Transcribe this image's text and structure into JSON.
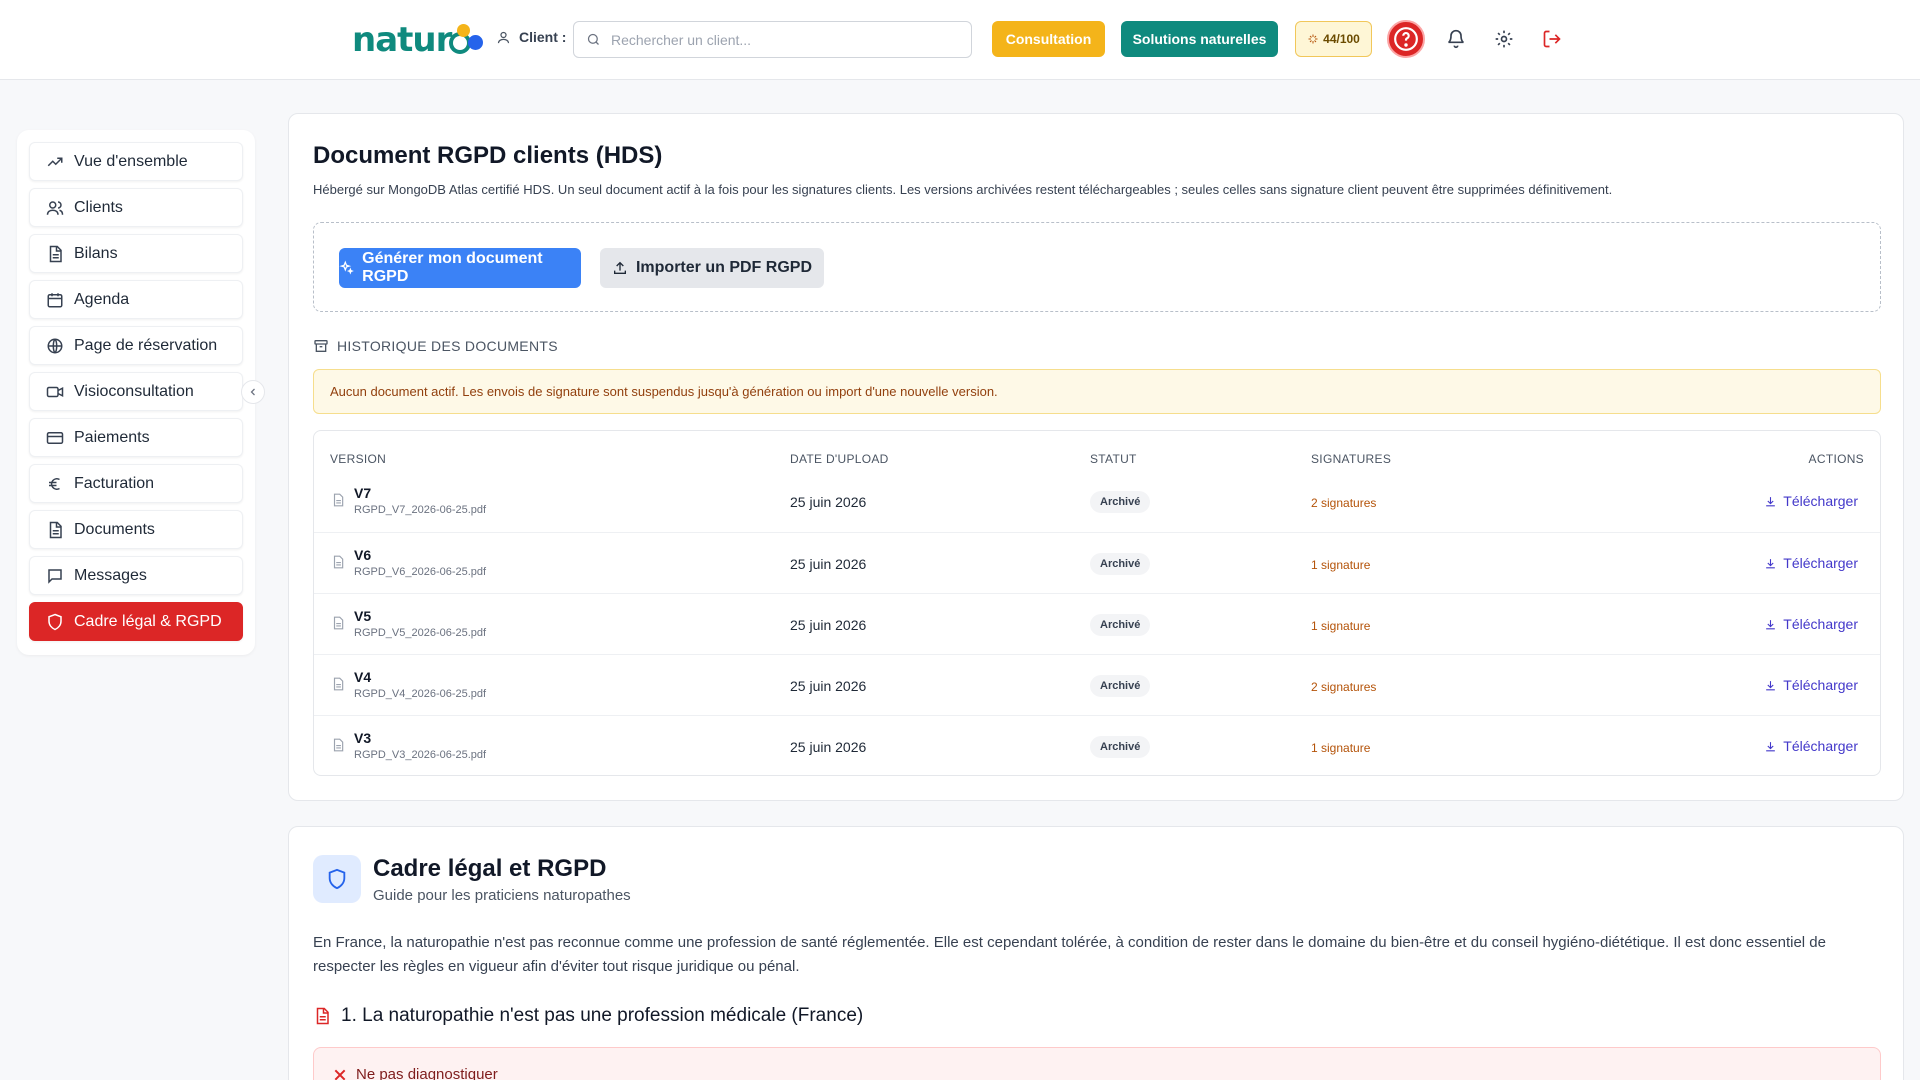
{
  "header": {
    "logo_text": "natur",
    "client_label": "Client :",
    "search_placeholder": "Rechercher un client...",
    "consultation_label": "Consultation",
    "solutions_label": "Solutions naturelles",
    "score": "44/100"
  },
  "sidebar": {
    "items": [
      {
        "label": "Vue d'ensemble",
        "icon": "trending-up-icon"
      },
      {
        "label": "Clients",
        "icon": "users-icon"
      },
      {
        "label": "Bilans",
        "icon": "file-text-icon"
      },
      {
        "label": "Agenda",
        "icon": "calendar-icon"
      },
      {
        "label": "Page de réservation",
        "icon": "globe-icon"
      },
      {
        "label": "Visioconsultation",
        "icon": "video-icon"
      },
      {
        "label": "Paiements",
        "icon": "credit-card-icon"
      },
      {
        "label": "Facturation",
        "icon": "euro-icon"
      },
      {
        "label": "Documents",
        "icon": "file-text-icon"
      },
      {
        "label": "Messages",
        "icon": "message-icon"
      },
      {
        "label": "Cadre légal & RGPD",
        "icon": "shield-icon",
        "active": true
      }
    ]
  },
  "rgpd": {
    "title": "Document RGPD clients (HDS)",
    "description": "Hébergé sur MongoDB Atlas certifié HDS. Un seul document actif à la fois pour les signatures clients. Les versions archivées restent téléchargeables ; seules celles sans signature client peuvent être supprimées définitivement.",
    "generate_label": "Générer mon document RGPD",
    "import_label": "Importer un PDF RGPD",
    "history_title": "HISTORIQUE DES DOCUMENTS",
    "warning": "Aucun document actif. Les envois de signature sont suspendus jusqu'à génération ou import d'une nouvelle version.",
    "columns": {
      "version": "VERSION",
      "date": "DATE D'UPLOAD",
      "status": "STATUT",
      "signatures": "SIGNATURES",
      "actions": "ACTIONS"
    },
    "rows": [
      {
        "version": "V7",
        "file": "RGPD_V7_2026-06-25.pdf",
        "date": "25 juin 2026",
        "status": "Archivé",
        "signatures": "2 signatures",
        "action": "Télécharger"
      },
      {
        "version": "V6",
        "file": "RGPD_V6_2026-06-25.pdf",
        "date": "25 juin 2026",
        "status": "Archivé",
        "signatures": "1 signature",
        "action": "Télécharger"
      },
      {
        "version": "V5",
        "file": "RGPD_V5_2026-06-25.pdf",
        "date": "25 juin 2026",
        "status": "Archivé",
        "signatures": "1 signature",
        "action": "Télécharger"
      },
      {
        "version": "V4",
        "file": "RGPD_V4_2026-06-25.pdf",
        "date": "25 juin 2026",
        "status": "Archivé",
        "signatures": "2 signatures",
        "action": "Télécharger"
      },
      {
        "version": "V3",
        "file": "RGPD_V3_2026-06-25.pdf",
        "date": "25 juin 2026",
        "status": "Archivé",
        "signatures": "1 signature",
        "action": "Télécharger"
      }
    ]
  },
  "legal": {
    "title": "Cadre légal et RGPD",
    "subtitle": "Guide pour les praticiens naturopathes",
    "paragraph": "En France, la naturopathie n'est pas reconnue comme une profession de santé réglementée. Elle est cependant tolérée, à condition de rester dans le domaine du bien-être et du conseil hygiéno-diététique. Il est donc essentiel de respecter les règles en vigueur afin d'éviter tout risque juridique ou pénal.",
    "section_title": "1. La naturopathie n'est pas une profession médicale (France)",
    "box_title": "Ne pas diagnostiquer"
  },
  "colors": {
    "brand": "#0f8a7e",
    "accent_yellow": "#f4b41a",
    "primary_blue": "#3b82f6",
    "active_red": "#dc2626"
  }
}
